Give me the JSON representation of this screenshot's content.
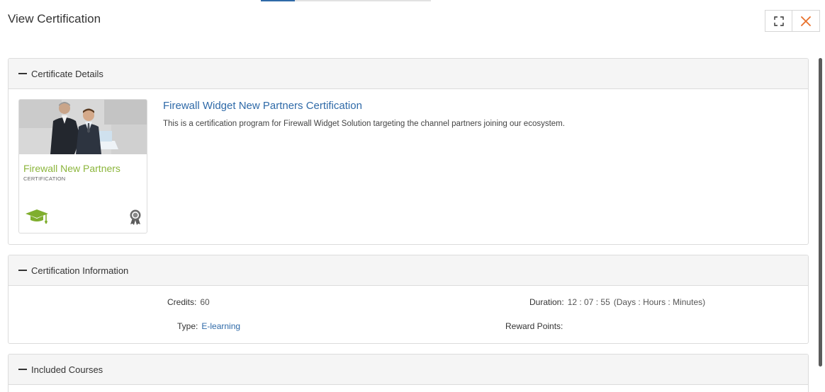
{
  "modal": {
    "title": "View Certification"
  },
  "sections": {
    "details": {
      "header": "Certificate Details",
      "card": {
        "title": "Firewall New Partners",
        "subtitle": "CERTIFICATION"
      },
      "cert_title": "Firewall Widget New Partners Certification",
      "description": "This is a certification program for Firewall Widget Solution targeting the channel partners joining our ecosystem."
    },
    "info": {
      "header": "Certification Information",
      "credits_label": "Credits:",
      "credits_value": "60",
      "duration_label": "Duration:",
      "duration_value": "12 : 07 : 55",
      "duration_unit": "(Days : Hours : Minutes)",
      "type_label": "Type:",
      "type_value": "E-learning",
      "reward_label": "Reward Points:",
      "reward_value": ""
    },
    "courses": {
      "header": "Included Courses"
    }
  },
  "icons": {
    "expand": "expand-icon",
    "close": "close-icon",
    "graduation_cap": "graduation-cap-icon",
    "award": "award-icon"
  },
  "colors": {
    "accent_link": "#2f6aa8",
    "card_title_green": "#8cb63c",
    "close_orange": "#e8702a"
  }
}
